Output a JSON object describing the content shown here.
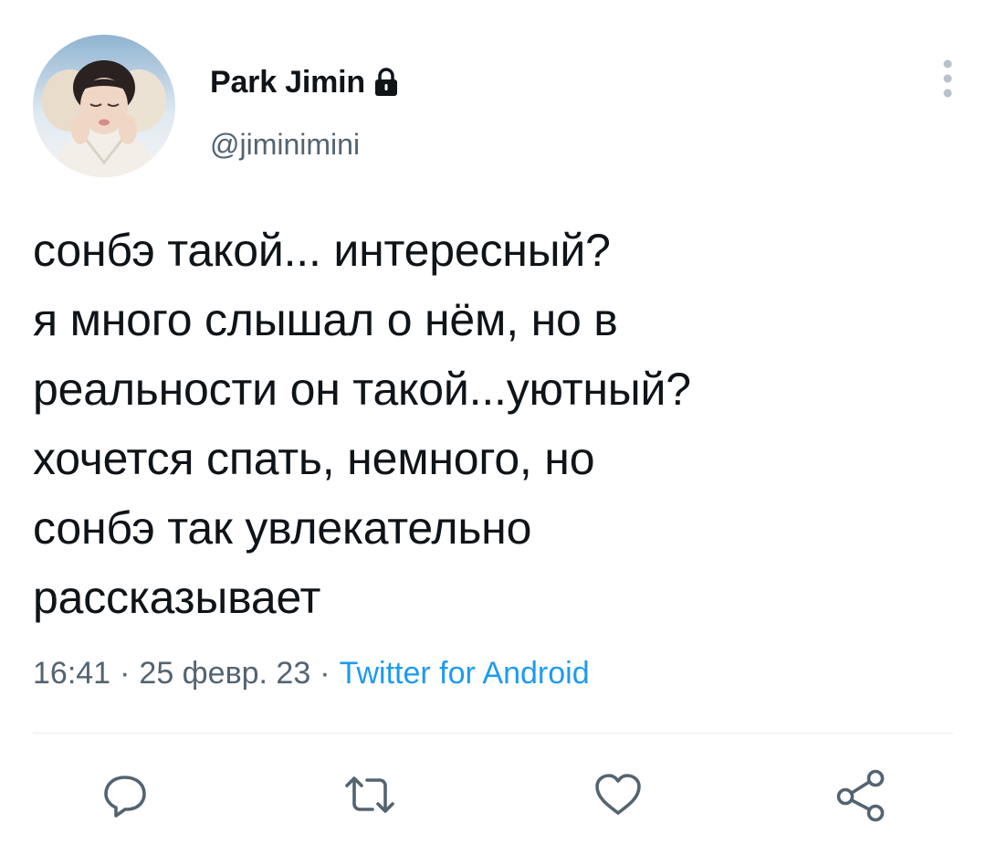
{
  "user": {
    "display_name": "Park Jimin",
    "handle": "@jiminimini",
    "protected_icon": "lock-icon",
    "avatar": "profile-photo"
  },
  "tweet": {
    "text": "сонбэ такой... интересный?\nя много слышал о нём, но в\nреальности он такой...уютный?\nхочется спать, немного, но\nсонбэ так увлекательно\nрассказывает",
    "time": "16:41",
    "separator": "·",
    "date": "25 февр. 23",
    "source": "Twitter for Android"
  },
  "actions": {
    "reply_icon": "reply-icon",
    "retweet_icon": "retweet-icon",
    "like_icon": "heart-icon",
    "share_icon": "share-icon"
  },
  "colors": {
    "text": "#0f1419",
    "secondary": "#536471",
    "accent": "#1d9bf0",
    "icon": "#536471",
    "divider": "#e6ecf0"
  }
}
